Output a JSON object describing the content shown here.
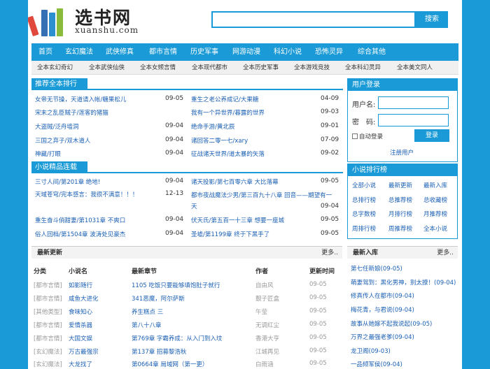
{
  "header": {
    "site_name": "选书网",
    "site_domain": "xuanshu.com",
    "search_button": "搜索",
    "search_value": ""
  },
  "nav": [
    "首页",
    "玄幻魔法",
    "武侠修真",
    "都市言情",
    "历史军事",
    "网游动漫",
    "科幻小说",
    "恐怖灵异",
    "综合其他"
  ],
  "subnav": [
    "全本玄幻奇幻",
    "全本武侠仙侠",
    "全本女频言情",
    "全本现代都市",
    "全本历史军事",
    "全本游戏竞技",
    "全本科幻灵异",
    "全本美文同人"
  ],
  "ranking": {
    "title": "推荐全本排行",
    "left": [
      {
        "text": "女帝无节操，天道请入帐/糖果松儿",
        "date": "09-05"
      },
      {
        "text": "宋末之乱臣贼子/莲客的猪猫",
        "date": ""
      },
      {
        "text": "大盗贼/泛舟墙洞",
        "date": "09-04"
      },
      {
        "text": "三国之弃子/双木道人",
        "date": "09-04"
      },
      {
        "text": "神藏/打眼",
        "date": "09-04"
      }
    ],
    "right": [
      {
        "text": "重生之老公养成记/大果糖",
        "date": "04-09"
      },
      {
        "text": "我有一个异世界/暮露的世界",
        "date": "09-03"
      },
      {
        "text": "绝命手游/黄北辰",
        "date": "09-01"
      },
      {
        "text": "诸回答二零一七/xary",
        "date": "07-09"
      },
      {
        "text": "征战诸天世界/道太暴的矢落",
        "date": "09-02"
      }
    ]
  },
  "serial": {
    "title": "小说精品连载",
    "left": [
      {
        "text": "三寸人间/第201章 绝地!",
        "date": "09-04"
      },
      {
        "text": "天域苍穹/完本感言：我很不满意！！！",
        "date": "12-13"
      },
      {
        "text": "",
        "date": ""
      },
      {
        "text": "重生奋斗俏甜妻/第1031章 不爽口",
        "date": "09-04"
      },
      {
        "text": "俗人回档/第1504章 波涛处见豪杰",
        "date": "09-04"
      }
    ],
    "right": [
      {
        "text": "诸天投影/第七百零六章 大比落幕",
        "date": "09-05"
      },
      {
        "text": "都市夜战魔法少男/第三百九十八章 回音——期望有一天",
        "date": "09-04"
      },
      {
        "text": "",
        "date": ""
      },
      {
        "text": "伏天氏/第五百一十三章 想要一座城",
        "date": "09-05"
      },
      {
        "text": "圣墟/第1199章 终于下黑手了",
        "date": "09-05"
      }
    ]
  },
  "login": {
    "title": "用户登录",
    "username_label": "用户名:",
    "password_label": "密　码:",
    "auto_login": "自动登录",
    "login_button": "登录",
    "register": "注册用户"
  },
  "novel_rank": {
    "title": "小说排行榜",
    "items": [
      "全部小说",
      "最新更新",
      "最新入库",
      "总排行榜",
      "总推荐榜",
      "总收藏榜",
      "总字数榜",
      "月排行榜",
      "月推荐榜",
      "周排行榜",
      "周推荐榜",
      "全本小说"
    ]
  },
  "latest": {
    "title": "最新更新",
    "more": "更多..",
    "headers": [
      "分类",
      "小说名",
      "最新章节",
      "作者",
      "更新时间"
    ],
    "rows": [
      [
        "[都市言情]",
        "如影随行",
        "1105 吃饭只要能够填饱肚子就行",
        "自由风",
        "09-05"
      ],
      [
        "[都市言情]",
        "咸鱼大进化",
        "341恶魔，阿尔萨斯",
        "靓子匠盒",
        "09-05"
      ],
      [
        "[其他类型]",
        "食味知心",
        "养生糕点 三",
        "午莹",
        "09-05"
      ],
      [
        "[都市言情]",
        "爱情杀器",
        "第八十八章",
        "无调红尘",
        "09-05"
      ],
      [
        "[都市言情]",
        "大国文娱",
        "第769章 字霸养成：从入门到入坟",
        "香港大亨",
        "09-05"
      ],
      [
        "[玄幻魔法]",
        "万古最强宗",
        "第137章 招募黎浩秋",
        "江城再见",
        "09-05"
      ],
      [
        "[玄幻魔法]",
        "大龙找了",
        "第0664章 局域网（第一更）",
        "白雨涵",
        "09-05"
      ]
    ]
  },
  "newest": {
    "title": "最新入库",
    "more": "更多..",
    "items": [
      "第七任新娘(09-05)",
      "萌妻驾到：黑化男神，别太撩！(09-04)",
      "修真传人在都市(09-04)",
      "梅花青，与君说(09-04)",
      "故事从她嫁不起我说起(09-05)",
      "万界之最强老爹(09-04)",
      "龙卫阁(09-03)",
      "一品倾军侯(09-04)"
    ]
  },
  "colors": {
    "accent": "#1a9ad6",
    "page_bg": "#1a9ad6"
  }
}
